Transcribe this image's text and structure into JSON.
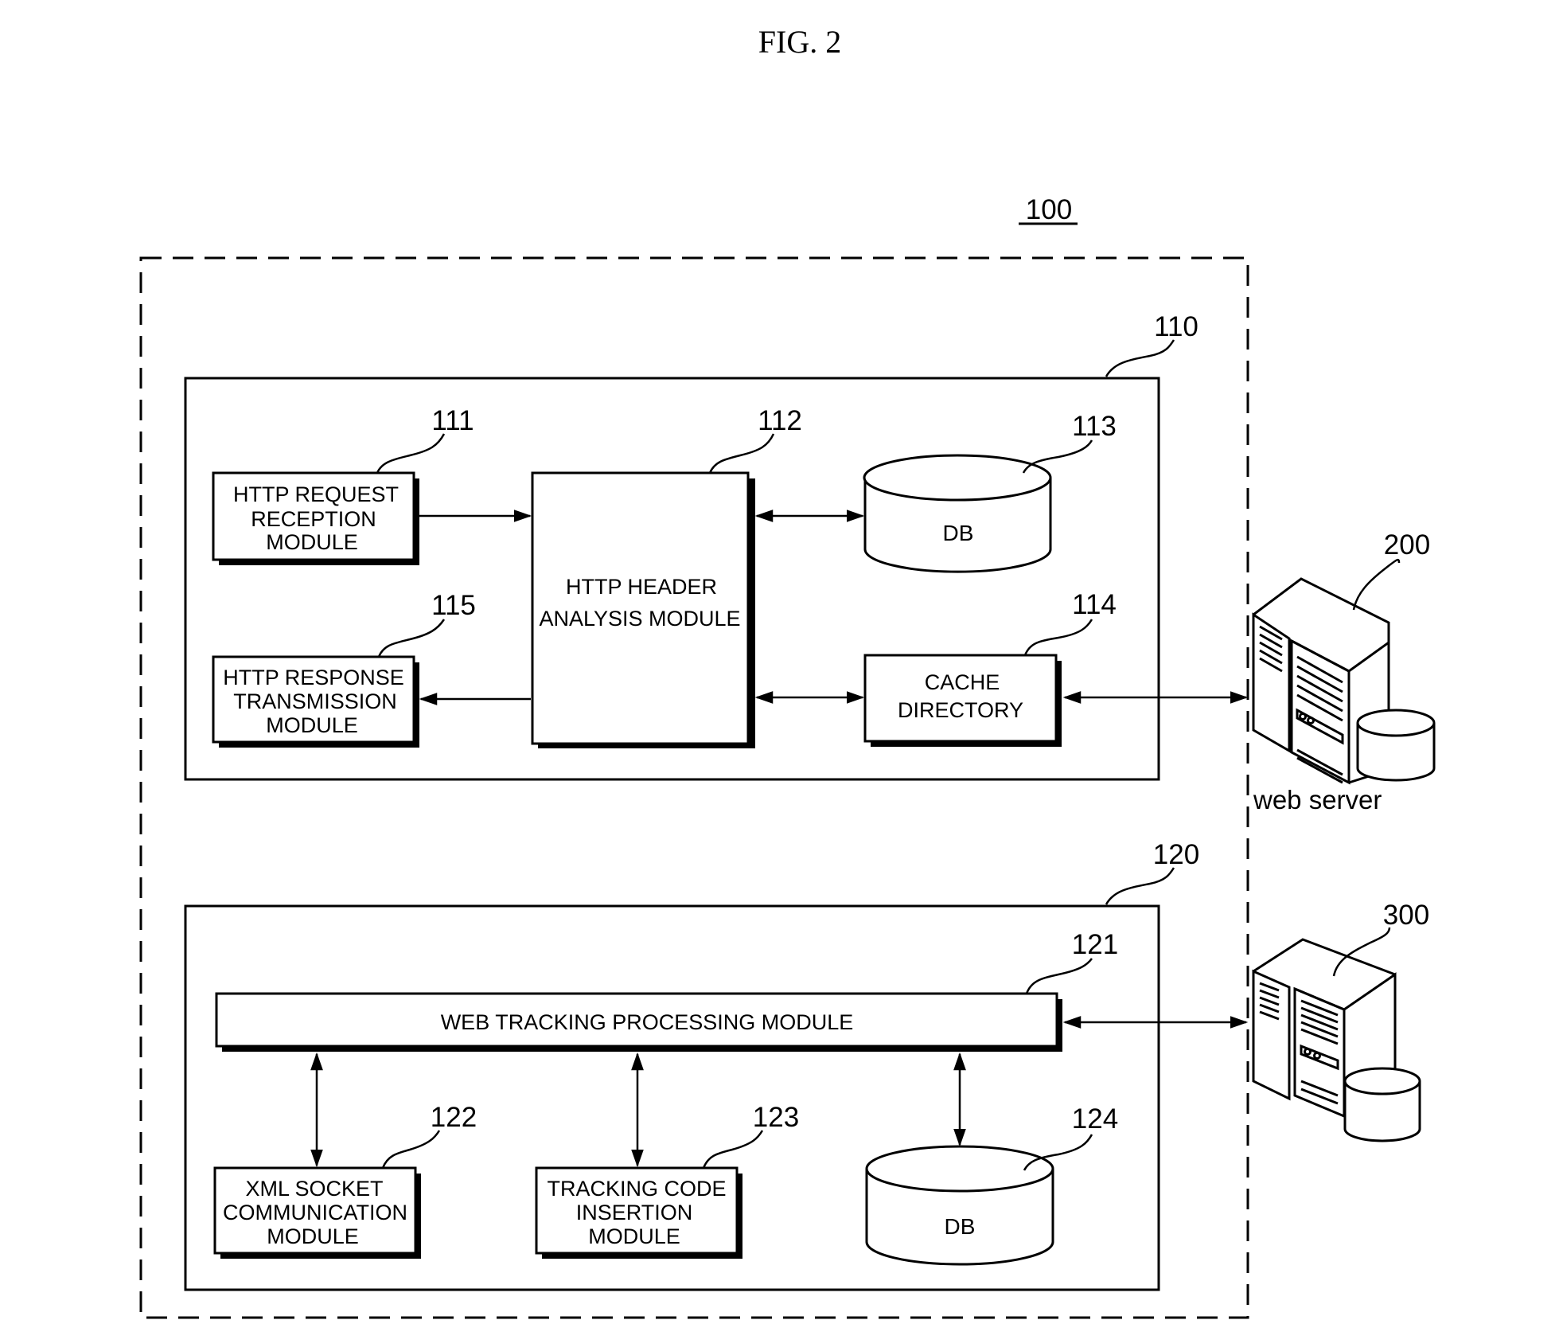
{
  "figure": {
    "title": "FIG. 2"
  },
  "system": {
    "ref": "100"
  },
  "block_110": {
    "ref": "110",
    "modules": {
      "http_request": {
        "ref": "111",
        "lines": [
          "HTTP REQUEST",
          "RECEPTION",
          "MODULE"
        ]
      },
      "http_header": {
        "ref": "112",
        "lines": [
          "HTTP HEADER",
          "ANALYSIS MODULE"
        ]
      },
      "db": {
        "ref": "113",
        "label": "DB"
      },
      "cache": {
        "ref": "114",
        "lines": [
          "CACHE",
          "DIRECTORY"
        ]
      },
      "http_response": {
        "ref": "115",
        "lines": [
          "HTTP RESPONSE",
          "TRANSMISSION",
          "MODULE"
        ]
      }
    }
  },
  "block_120": {
    "ref": "120",
    "modules": {
      "web_tracking": {
        "ref": "121",
        "label": "WEB TRACKING PROCESSING MODULE"
      },
      "xml_socket": {
        "ref": "122",
        "lines": [
          "XML SOCKET",
          "COMMUNICATION",
          "MODULE"
        ]
      },
      "tracking_code": {
        "ref": "123",
        "lines": [
          "TRACKING CODE",
          "INSERTION",
          "MODULE"
        ]
      },
      "db": {
        "ref": "124",
        "label": "DB"
      }
    }
  },
  "external": {
    "web_server": {
      "ref": "200",
      "label": "web server"
    },
    "server_300": {
      "ref": "300"
    }
  },
  "connections": [
    {
      "from": "111",
      "to": "112",
      "direction": "one-way"
    },
    {
      "from": "112",
      "to": "115",
      "direction": "one-way"
    },
    {
      "from": "112",
      "to": "113",
      "direction": "two-way"
    },
    {
      "from": "112",
      "to": "114",
      "direction": "two-way"
    },
    {
      "from": "114",
      "to": "200",
      "direction": "two-way"
    },
    {
      "from": "121",
      "to": "300",
      "direction": "two-way"
    },
    {
      "from": "121",
      "to": "122",
      "direction": "two-way"
    },
    {
      "from": "121",
      "to": "123",
      "direction": "two-way"
    },
    {
      "from": "121",
      "to": "124",
      "direction": "two-way"
    }
  ]
}
